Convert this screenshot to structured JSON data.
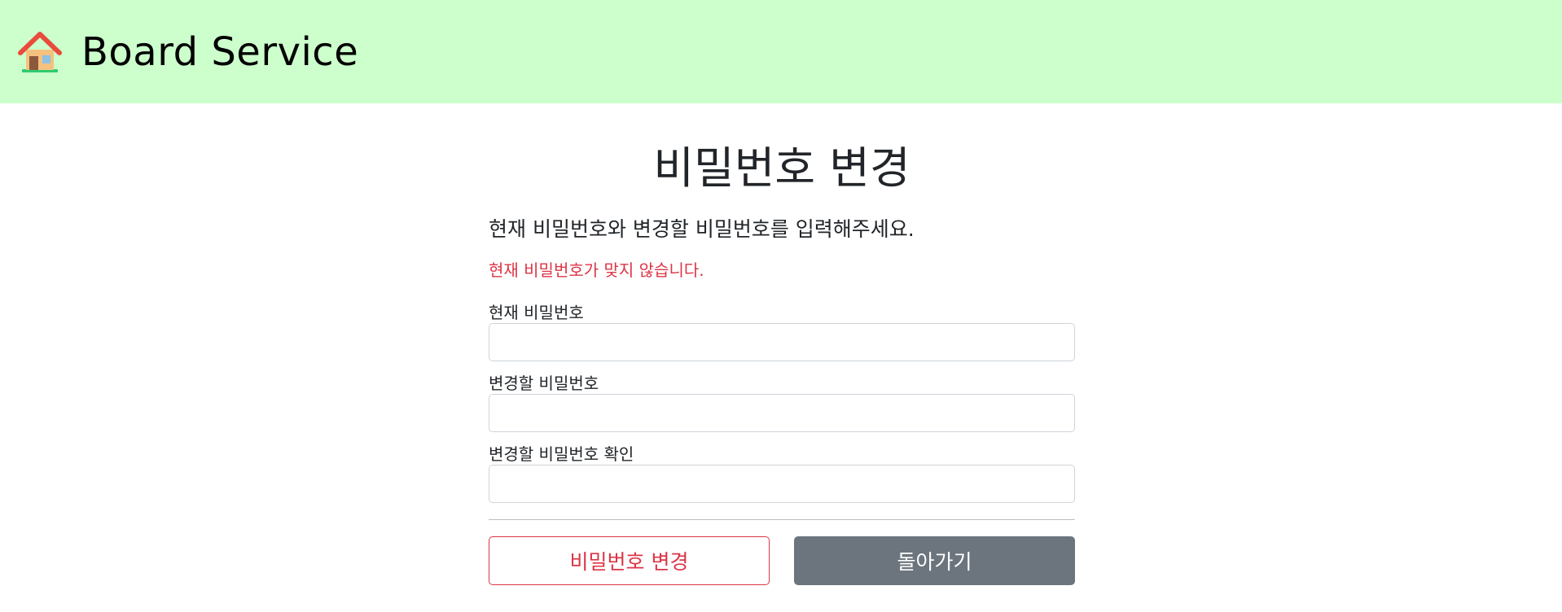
{
  "navbar": {
    "brand_text": "Board Service",
    "brand_icon": "house-icon"
  },
  "main": {
    "title": "비밀번호 변경",
    "lead": "현재 비밀번호와 변경할 비밀번호를 입력해주세요.",
    "error": "현재 비밀번호가 맞지 않습니다.",
    "fields": [
      {
        "label": "현재 비밀번호",
        "value": ""
      },
      {
        "label": "변경할 비밀번호",
        "value": ""
      },
      {
        "label": "변경할 비밀번호 확인",
        "value": ""
      }
    ],
    "buttons": {
      "submit_label": "비밀번호 변경",
      "back_label": "돌아가기"
    }
  },
  "colors": {
    "navbar_bg": "#ccffcc",
    "danger": "#dc3545",
    "secondary": "#6c757d"
  }
}
